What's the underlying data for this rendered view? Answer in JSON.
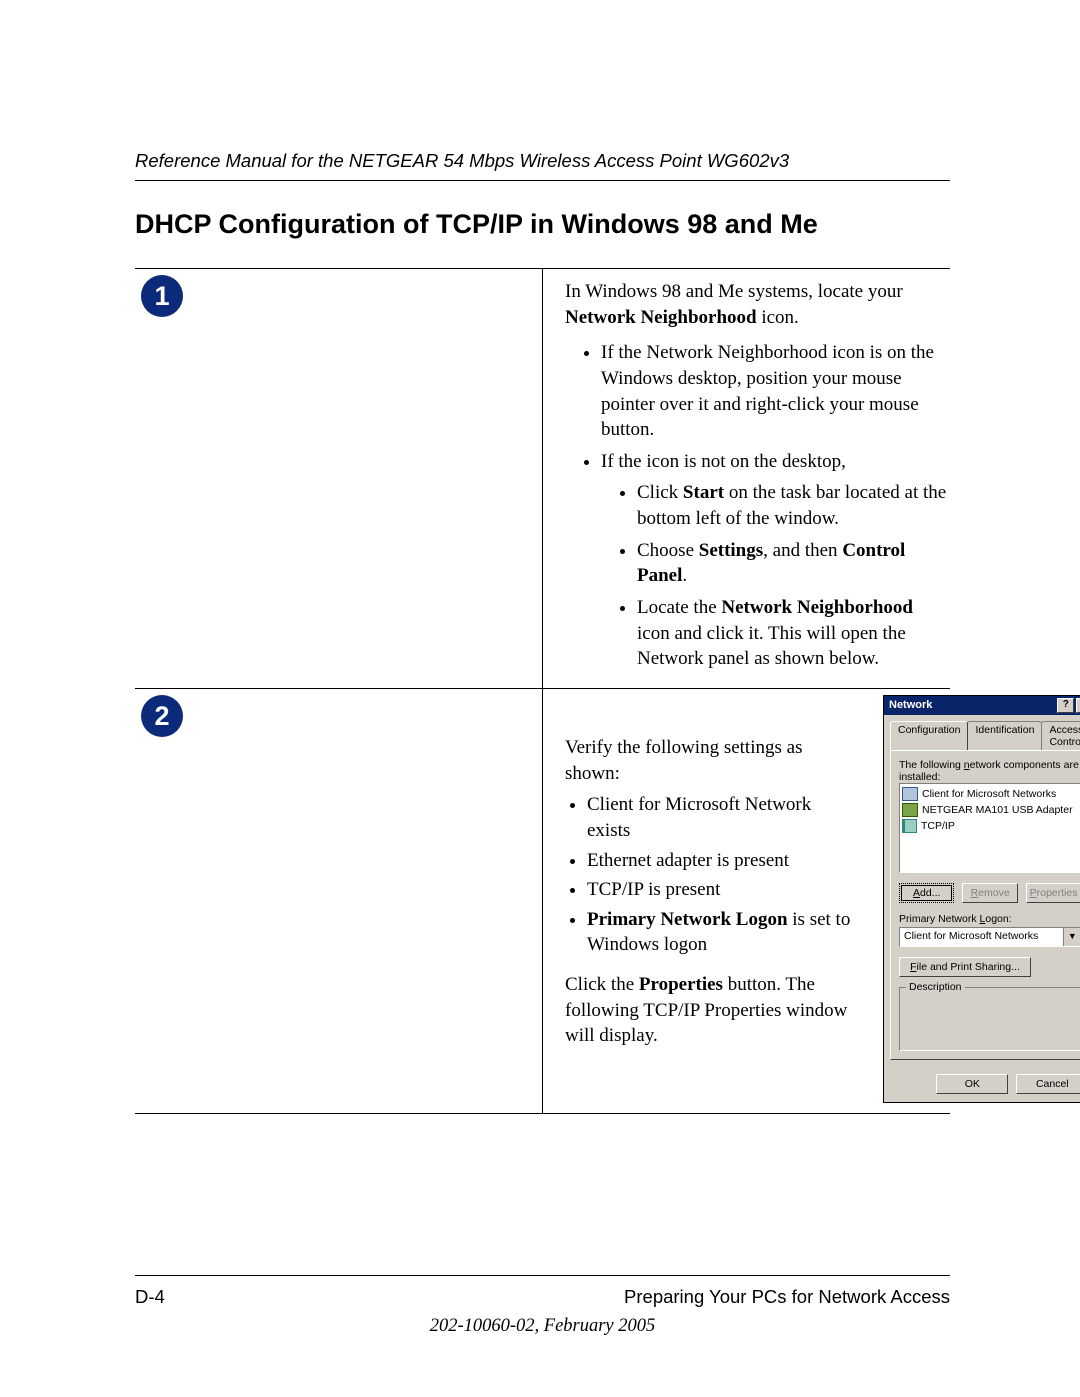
{
  "header": {
    "running_head": "Reference Manual for the NETGEAR 54 Mbps Wireless Access Point WG602v3"
  },
  "section_title": "DHCP Configuration of TCP/IP in Windows 98 and Me",
  "steps": {
    "one": {
      "number": "1",
      "intro_pre": "In Windows 98 and Me systems, locate your ",
      "intro_bold": "Network Neighborhood",
      "intro_post": " icon.",
      "b1a": "If the Network Neighborhood icon is on the Windows desktop, position your mouse pointer over it and right-click your mouse button.",
      "b1b": "If the icon is not on the desktop,",
      "b2a_pre": "Click ",
      "b2a_bold": "Start",
      "b2a_post": " on the task bar located at the bottom left of the window.",
      "b2b_pre": "Choose ",
      "b2b_bold1": "Settings",
      "b2b_mid": ", and then ",
      "b2b_bold2": "Control Panel",
      "b2b_post": ".",
      "b2c_pre": "Locate the ",
      "b2c_bold": "Network Neighborhood",
      "b2c_post": " icon and click it. This will open the Network panel as shown below."
    },
    "two": {
      "number": "2",
      "verify_intro": "Verify the following settings as shown:",
      "v1": "Client for Microsoft Network exists",
      "v2": "Ethernet adapter is present",
      "v3": "TCP/IP is present",
      "v4_bold": "Primary Network Logon",
      "v4_post": " is set to Windows logon",
      "after_pre": "Click the ",
      "after_bold": "Properties",
      "after_post": " button. The following TCP/IP Properties window will display."
    }
  },
  "dialog": {
    "title": "Network",
    "help_btn": "?",
    "close_btn": "✕",
    "tabs": {
      "t1": "Configuration",
      "t2": "Identification",
      "t3": "Access Control"
    },
    "list_label_pre": "The following ",
    "list_label_key": "n",
    "list_label_post": "etwork components are installed:",
    "items": {
      "i1": "Client for Microsoft Networks",
      "i2": "NETGEAR MA101 USB Adapter",
      "i3": "TCP/IP"
    },
    "buttons": {
      "add_key": "A",
      "add_rest": "dd...",
      "remove_key": "R",
      "remove_rest": "emove",
      "props_key": "P",
      "props_rest": "roperties"
    },
    "logon_label_pre": "Primary Network ",
    "logon_label_key": "L",
    "logon_label_post": "ogon:",
    "logon_value": "Client for Microsoft Networks",
    "fileshare_key": "F",
    "fileshare_rest": "ile and Print Sharing...",
    "group_label": "Description",
    "ok": "OK",
    "cancel": "Cancel",
    "arrow": "▼"
  },
  "footer": {
    "page": "D-4",
    "chapter": "Preparing Your PCs for Network Access",
    "docinfo": "202-10060-02, February 2005"
  }
}
